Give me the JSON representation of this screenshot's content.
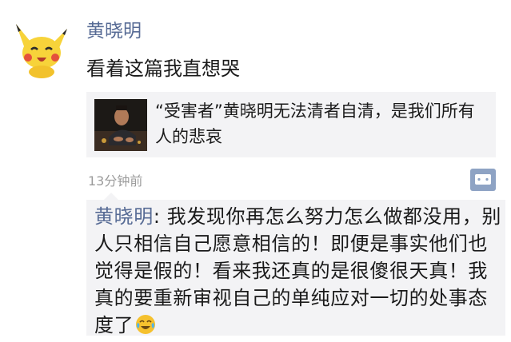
{
  "post": {
    "author": "黄晓明",
    "text": "看着这篇我直想哭",
    "link": {
      "title": "“受害者”黄晓明无法清者自清，是我们所有人的悲哀"
    },
    "time": "13分钟前"
  },
  "comment": {
    "author": "黄晓明",
    "separator": ": ",
    "text": "我发现你再怎么努力怎么做都没用，别人只相信自己愿意相信的！即便是事实他们也觉得是假的！看来我还真的是很傻很天真！我真的要重新审视自己的单纯应对一切的处事态度了"
  },
  "icons": {
    "avatar": "pikachu-avatar",
    "comment": "comment-icon",
    "emoji": "crying-laughing-emoji"
  },
  "colors": {
    "name": "#576b95",
    "card_bg": "#f3f3f5",
    "comment_button": "#8ea3c4"
  }
}
